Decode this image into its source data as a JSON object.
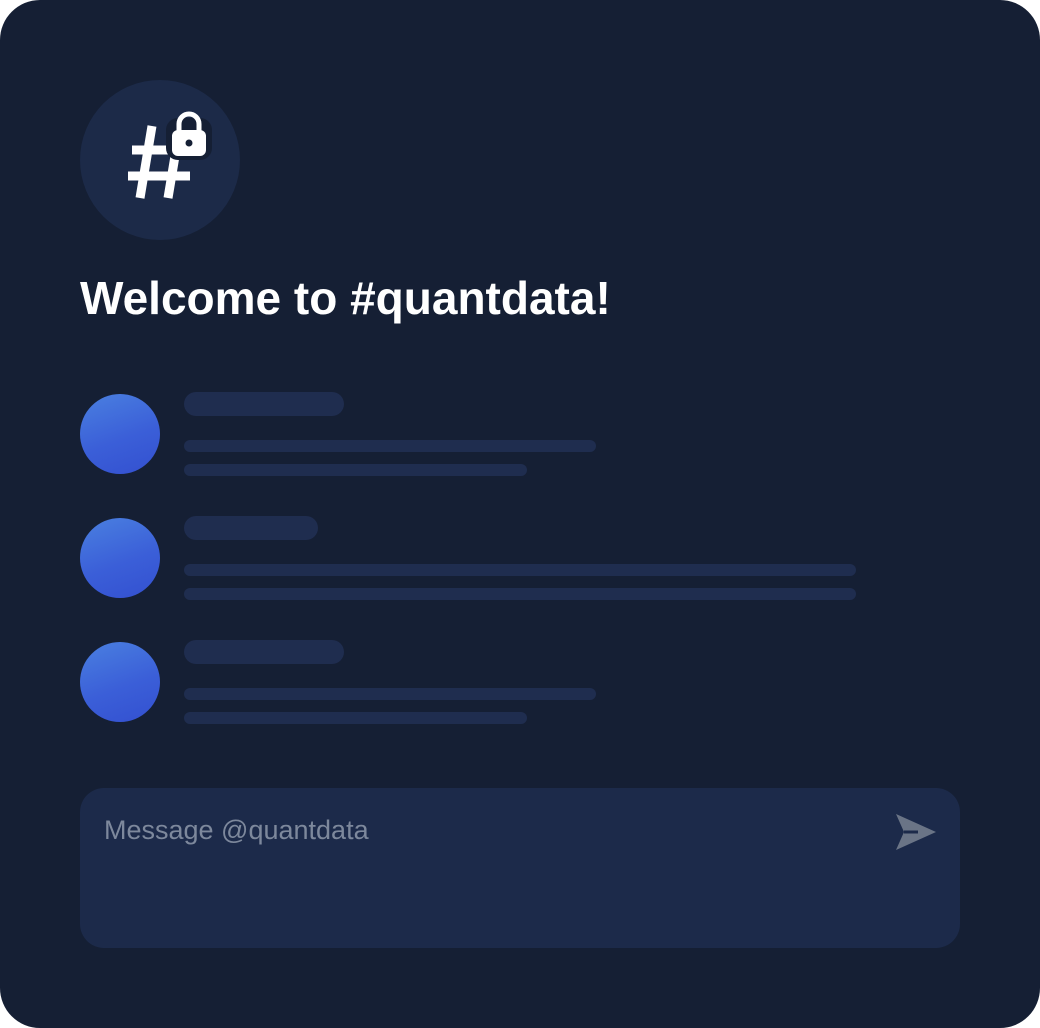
{
  "channel": {
    "icon": "hash-lock-icon",
    "welcome_text": "Welcome to #quantdata!"
  },
  "messages": [
    {
      "avatar_color_start": "#4a80e0",
      "avatar_color_end": "#3350d0",
      "status": "loading"
    },
    {
      "avatar_color_start": "#4a80e0",
      "avatar_color_end": "#3350d0",
      "status": "loading"
    },
    {
      "avatar_color_start": "#4a80e0",
      "avatar_color_end": "#3350d0",
      "status": "loading"
    }
  ],
  "composer": {
    "placeholder": "Message @quantdata",
    "value": "",
    "send_icon": "send-icon"
  },
  "colors": {
    "background": "#151f34",
    "surface": "#1c2a4a",
    "skeleton": "#1f2d4f",
    "text": "#ffffff",
    "placeholder": "#7d889c",
    "send_icon": "#6a7486"
  }
}
